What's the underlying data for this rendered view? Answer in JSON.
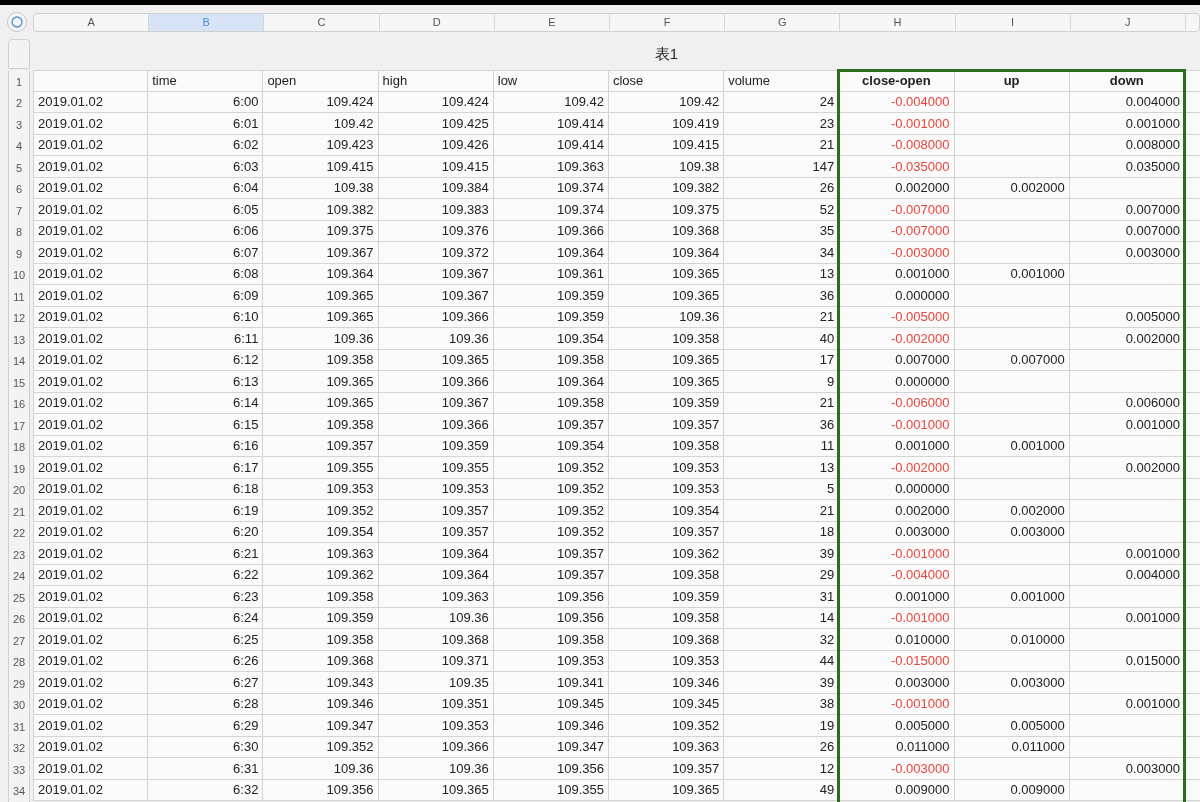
{
  "columns": [
    {
      "letter": "A",
      "selected": false
    },
    {
      "letter": "B",
      "selected": true
    },
    {
      "letter": "C",
      "selected": false
    },
    {
      "letter": "D",
      "selected": false
    },
    {
      "letter": "E",
      "selected": false
    },
    {
      "letter": "F",
      "selected": false
    },
    {
      "letter": "G",
      "selected": false
    },
    {
      "letter": "H",
      "selected": false
    },
    {
      "letter": "I",
      "selected": false
    },
    {
      "letter": "J",
      "selected": false
    }
  ],
  "table_title": "表1",
  "header_row": {
    "num": "1",
    "labels": [
      {
        "label": "time",
        "kind": "plain"
      },
      {
        "label": "open",
        "kind": "plain"
      },
      {
        "label": "high",
        "kind": "plain"
      },
      {
        "label": "low",
        "kind": "plain"
      },
      {
        "label": "close",
        "kind": "plain"
      },
      {
        "label": "volume",
        "kind": "plain"
      },
      {
        "label": "close-open",
        "kind": "computed"
      },
      {
        "label": "up",
        "kind": "computed"
      },
      {
        "label": "down",
        "kind": "computed"
      }
    ]
  },
  "rows": [
    {
      "num": "2",
      "negative": true,
      "cells": [
        "2019.01.02",
        "6:00",
        "109.424",
        "109.424",
        "109.42",
        "109.42",
        "24",
        "-0.004000",
        null,
        "0.004000"
      ]
    },
    {
      "num": "3",
      "negative": true,
      "cells": [
        "2019.01.02",
        "6:01",
        "109.42",
        "109.425",
        "109.414",
        "109.419",
        "23",
        "-0.001000",
        null,
        "0.001000"
      ]
    },
    {
      "num": "4",
      "negative": true,
      "cells": [
        "2019.01.02",
        "6:02",
        "109.423",
        "109.426",
        "109.414",
        "109.415",
        "21",
        "-0.008000",
        null,
        "0.008000"
      ]
    },
    {
      "num": "5",
      "negative": true,
      "cells": [
        "2019.01.02",
        "6:03",
        "109.415",
        "109.415",
        "109.363",
        "109.38",
        "147",
        "-0.035000",
        null,
        "0.035000"
      ]
    },
    {
      "num": "6",
      "negative": false,
      "cells": [
        "2019.01.02",
        "6:04",
        "109.38",
        "109.384",
        "109.374",
        "109.382",
        "26",
        "0.002000",
        "0.002000",
        null
      ]
    },
    {
      "num": "7",
      "negative": true,
      "cells": [
        "2019.01.02",
        "6:05",
        "109.382",
        "109.383",
        "109.374",
        "109.375",
        "52",
        "-0.007000",
        null,
        "0.007000"
      ]
    },
    {
      "num": "8",
      "negative": true,
      "cells": [
        "2019.01.02",
        "6:06",
        "109.375",
        "109.376",
        "109.366",
        "109.368",
        "35",
        "-0.007000",
        null,
        "0.007000"
      ]
    },
    {
      "num": "9",
      "negative": true,
      "cells": [
        "2019.01.02",
        "6:07",
        "109.367",
        "109.372",
        "109.364",
        "109.364",
        "34",
        "-0.003000",
        null,
        "0.003000"
      ]
    },
    {
      "num": "10",
      "negative": false,
      "cells": [
        "2019.01.02",
        "6:08",
        "109.364",
        "109.367",
        "109.361",
        "109.365",
        "13",
        "0.001000",
        "0.001000",
        null
      ]
    },
    {
      "num": "11",
      "negative": false,
      "cells": [
        "2019.01.02",
        "6:09",
        "109.365",
        "109.367",
        "109.359",
        "109.365",
        "36",
        "0.000000",
        null,
        null
      ]
    },
    {
      "num": "12",
      "negative": true,
      "cells": [
        "2019.01.02",
        "6:10",
        "109.365",
        "109.366",
        "109.359",
        "109.36",
        "21",
        "-0.005000",
        null,
        "0.005000"
      ]
    },
    {
      "num": "13",
      "negative": true,
      "cells": [
        "2019.01.02",
        "6:11",
        "109.36",
        "109.36",
        "109.354",
        "109.358",
        "40",
        "-0.002000",
        null,
        "0.002000"
      ]
    },
    {
      "num": "14",
      "negative": false,
      "cells": [
        "2019.01.02",
        "6:12",
        "109.358",
        "109.365",
        "109.358",
        "109.365",
        "17",
        "0.007000",
        "0.007000",
        null
      ]
    },
    {
      "num": "15",
      "negative": false,
      "cells": [
        "2019.01.02",
        "6:13",
        "109.365",
        "109.366",
        "109.364",
        "109.365",
        "9",
        "0.000000",
        null,
        null
      ]
    },
    {
      "num": "16",
      "negative": true,
      "cells": [
        "2019.01.02",
        "6:14",
        "109.365",
        "109.367",
        "109.358",
        "109.359",
        "21",
        "-0.006000",
        null,
        "0.006000"
      ]
    },
    {
      "num": "17",
      "negative": true,
      "cells": [
        "2019.01.02",
        "6:15",
        "109.358",
        "109.366",
        "109.357",
        "109.357",
        "36",
        "-0.001000",
        null,
        "0.001000"
      ]
    },
    {
      "num": "18",
      "negative": false,
      "cells": [
        "2019.01.02",
        "6:16",
        "109.357",
        "109.359",
        "109.354",
        "109.358",
        "11",
        "0.001000",
        "0.001000",
        null
      ]
    },
    {
      "num": "19",
      "negative": true,
      "cells": [
        "2019.01.02",
        "6:17",
        "109.355",
        "109.355",
        "109.352",
        "109.353",
        "13",
        "-0.002000",
        null,
        "0.002000"
      ]
    },
    {
      "num": "20",
      "negative": false,
      "cells": [
        "2019.01.02",
        "6:18",
        "109.353",
        "109.353",
        "109.352",
        "109.353",
        "5",
        "0.000000",
        null,
        null
      ]
    },
    {
      "num": "21",
      "negative": false,
      "cells": [
        "2019.01.02",
        "6:19",
        "109.352",
        "109.357",
        "109.352",
        "109.354",
        "21",
        "0.002000",
        "0.002000",
        null
      ]
    },
    {
      "num": "22",
      "negative": false,
      "cells": [
        "2019.01.02",
        "6:20",
        "109.354",
        "109.357",
        "109.352",
        "109.357",
        "18",
        "0.003000",
        "0.003000",
        null
      ]
    },
    {
      "num": "23",
      "negative": true,
      "cells": [
        "2019.01.02",
        "6:21",
        "109.363",
        "109.364",
        "109.357",
        "109.362",
        "39",
        "-0.001000",
        null,
        "0.001000"
      ]
    },
    {
      "num": "24",
      "negative": true,
      "cells": [
        "2019.01.02",
        "6:22",
        "109.362",
        "109.364",
        "109.357",
        "109.358",
        "29",
        "-0.004000",
        null,
        "0.004000"
      ]
    },
    {
      "num": "25",
      "negative": false,
      "cells": [
        "2019.01.02",
        "6:23",
        "109.358",
        "109.363",
        "109.356",
        "109.359",
        "31",
        "0.001000",
        "0.001000",
        null
      ]
    },
    {
      "num": "26",
      "negative": true,
      "cells": [
        "2019.01.02",
        "6:24",
        "109.359",
        "109.36",
        "109.356",
        "109.358",
        "14",
        "-0.001000",
        null,
        "0.001000"
      ]
    },
    {
      "num": "27",
      "negative": false,
      "cells": [
        "2019.01.02",
        "6:25",
        "109.358",
        "109.368",
        "109.358",
        "109.368",
        "32",
        "0.010000",
        "0.010000",
        null
      ]
    },
    {
      "num": "28",
      "negative": true,
      "cells": [
        "2019.01.02",
        "6:26",
        "109.368",
        "109.371",
        "109.353",
        "109.353",
        "44",
        "-0.015000",
        null,
        "0.015000"
      ]
    },
    {
      "num": "29",
      "negative": false,
      "cells": [
        "2019.01.02",
        "6:27",
        "109.343",
        "109.35",
        "109.341",
        "109.346",
        "39",
        "0.003000",
        "0.003000",
        null
      ]
    },
    {
      "num": "30",
      "negative": true,
      "cells": [
        "2019.01.02",
        "6:28",
        "109.346",
        "109.351",
        "109.345",
        "109.345",
        "38",
        "-0.001000",
        null,
        "0.001000"
      ]
    },
    {
      "num": "31",
      "negative": false,
      "cells": [
        "2019.01.02",
        "6:29",
        "109.347",
        "109.353",
        "109.346",
        "109.352",
        "19",
        "0.005000",
        "0.005000",
        null
      ]
    },
    {
      "num": "32",
      "negative": false,
      "cells": [
        "2019.01.02",
        "6:30",
        "109.352",
        "109.366",
        "109.347",
        "109.363",
        "26",
        "0.011000",
        "0.011000",
        null
      ]
    },
    {
      "num": "33",
      "negative": true,
      "cells": [
        "2019.01.02",
        "6:31",
        "109.36",
        "109.36",
        "109.356",
        "109.357",
        "12",
        "-0.003000",
        null,
        "0.003000"
      ]
    },
    {
      "num": "34",
      "negative": false,
      "cells": [
        "2019.01.02",
        "6:32",
        "109.356",
        "109.365",
        "109.355",
        "109.365",
        "49",
        "0.009000",
        "0.009000",
        null
      ]
    }
  ]
}
